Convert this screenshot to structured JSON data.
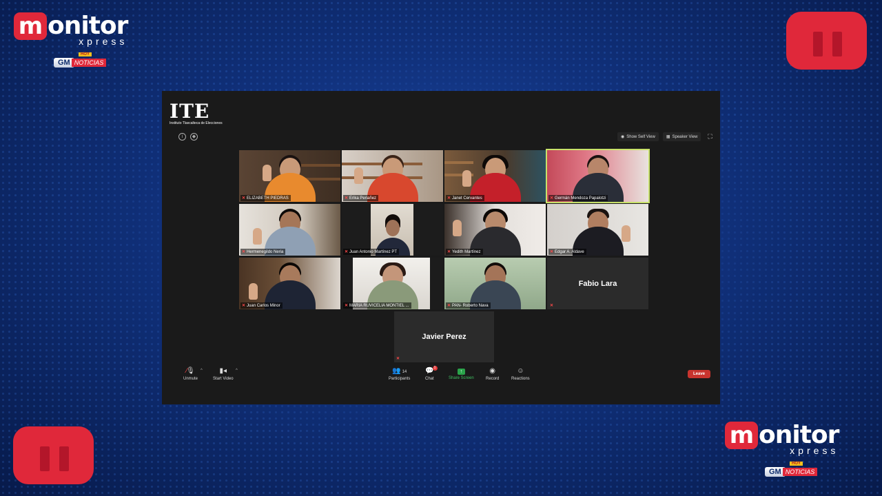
{
  "branding": {
    "logo_m": "m",
    "logo_rest": "onitor",
    "logo_sub": "xpress",
    "gm_label": "GM",
    "hoy_label": "HOY",
    "noticias_label": "NOTICIAS",
    "accent_color": "#e0283a"
  },
  "meeting": {
    "org_logo_big": "ITE",
    "org_logo_small": "Instituto Tlaxcalteca de Elecciones",
    "show_self_view": "Show Self View",
    "speaker_view": "Speaker View",
    "participants": [
      {
        "name": "ELIZABETH PIEDRAS"
      },
      {
        "name": "Erika Periañez"
      },
      {
        "name": "Janet Cervantes"
      },
      {
        "name": "Germán Mendoza Papalotzi"
      },
      {
        "name": "Hermenegildo Neria"
      },
      {
        "name": "Juan Antonio Martínez PT"
      },
      {
        "name": "Yedith Martínez"
      },
      {
        "name": "Edgar A. Aldave"
      },
      {
        "name": "Juan Carlos Minor"
      },
      {
        "name": "MARIA RUVICELIA MONTIEL ..."
      },
      {
        "name": "PAN- Roberto Nava"
      },
      {
        "name": "Fabio Lara"
      }
    ],
    "extra_participant": "Javier Perez"
  },
  "toolbar": {
    "unmute": "Unmute",
    "start_video": "Start Video",
    "participants_label": "Participants",
    "participants_count": "14",
    "chat_label": "Chat",
    "chat_badge": "1",
    "share_label": "Share Screen",
    "record_label": "Record",
    "reactions_label": "Reactions",
    "leave_label": "Leave"
  }
}
